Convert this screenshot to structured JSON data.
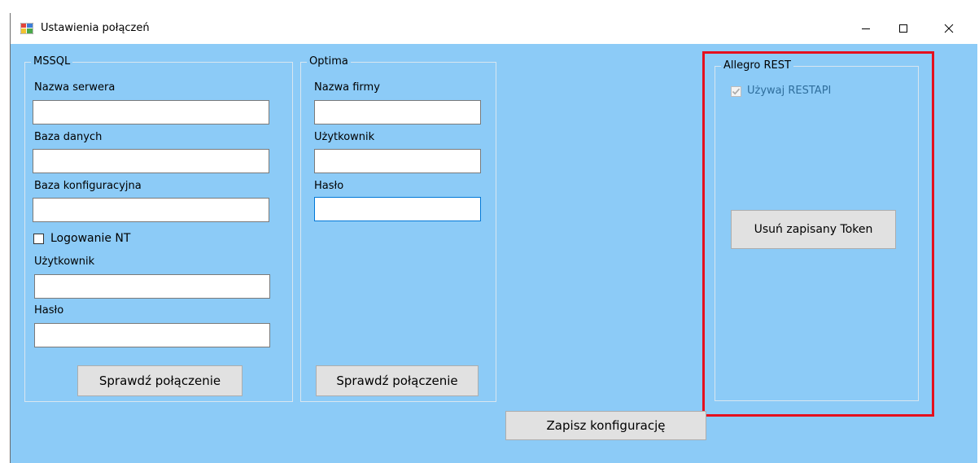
{
  "window": {
    "title": "Ustawienia połączeń",
    "controls": {
      "minimize": "–",
      "maximize": "☐",
      "close": "✕"
    }
  },
  "mssql": {
    "legend": "MSSQL",
    "server_label": "Nazwa serwera",
    "server_value": "",
    "database_label": "Baza danych",
    "database_value": "",
    "config_db_label": "Baza konfiguracyjna",
    "config_db_value": "",
    "nt_login_label": "Logowanie NT",
    "nt_login_checked": false,
    "user_label": "Użytkownik",
    "user_value": "",
    "password_label": "Hasło",
    "password_value": "",
    "test_button": "Sprawdź połączenie"
  },
  "optima": {
    "legend": "Optima",
    "company_label": "Nazwa firmy",
    "company_value": "",
    "user_label": "Użytkownik",
    "user_value": "",
    "password_label": "Hasło",
    "password_value": "",
    "test_button": "Sprawdź połączenie"
  },
  "allegro": {
    "legend": "Allegro REST",
    "use_restapi_label": "Używaj RESTAPI",
    "use_restapi_checked": true,
    "remove_token_button": "Usuń zapisany Token"
  },
  "footer": {
    "save_button": "Zapisz konfigurację"
  },
  "colors": {
    "window_bg": "#8ccbf7",
    "highlight": "#e5101e",
    "focus_border": "#0078d7"
  }
}
